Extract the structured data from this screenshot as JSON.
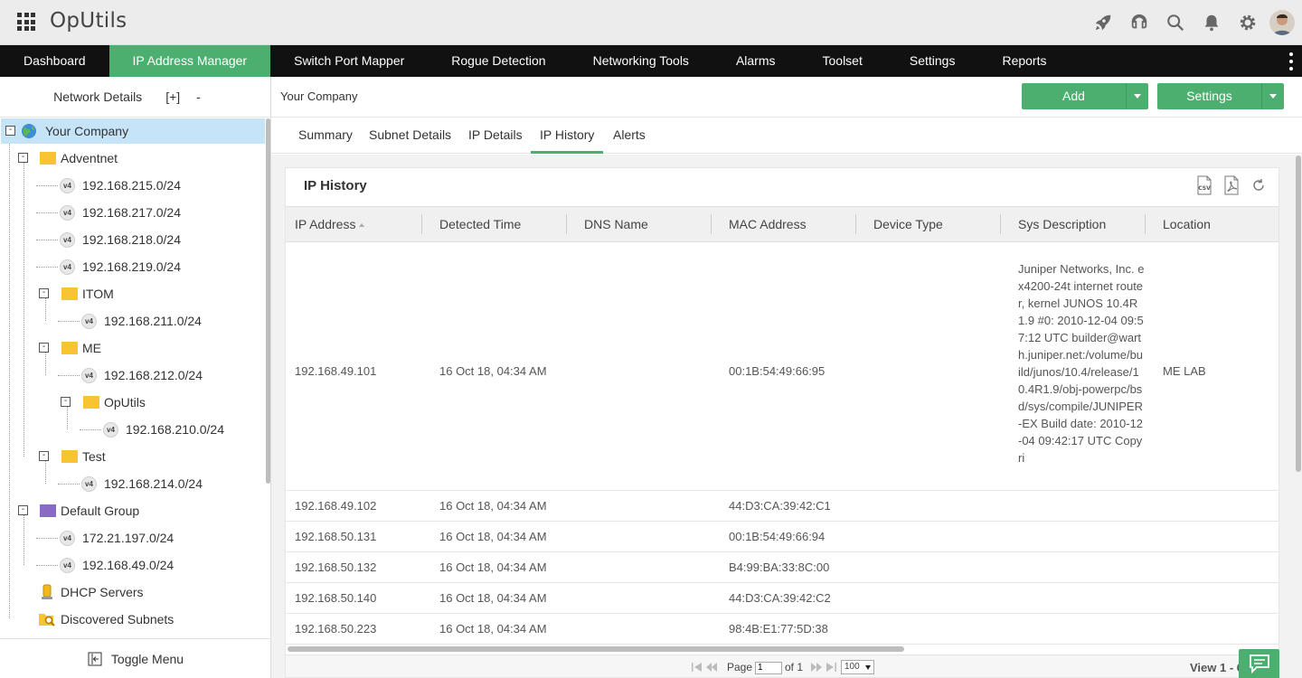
{
  "app": {
    "title": "OpUtils"
  },
  "nav": {
    "items": [
      {
        "label": "Dashboard"
      },
      {
        "label": "IP Address Manager"
      },
      {
        "label": "Switch Port Mapper"
      },
      {
        "label": "Rogue Detection"
      },
      {
        "label": "Networking Tools"
      },
      {
        "label": "Alarms"
      },
      {
        "label": "Toolset"
      },
      {
        "label": "Settings"
      },
      {
        "label": "Reports"
      }
    ],
    "active": "IP Address Manager"
  },
  "sidebar": {
    "title": "Network Details",
    "expand_label": "[+]",
    "collapse_label": "-",
    "tree": [
      {
        "label": "Your Company"
      },
      {
        "label": "Adventnet"
      },
      {
        "label": "192.168.215.0/24"
      },
      {
        "label": "192.168.217.0/24"
      },
      {
        "label": "192.168.218.0/24"
      },
      {
        "label": "192.168.219.0/24"
      },
      {
        "label": "ITOM"
      },
      {
        "label": "192.168.211.0/24"
      },
      {
        "label": "ME"
      },
      {
        "label": "192.168.212.0/24"
      },
      {
        "label": "OpUtils"
      },
      {
        "label": "192.168.210.0/24"
      },
      {
        "label": "Test"
      },
      {
        "label": "192.168.214.0/24"
      },
      {
        "label": "Default Group"
      },
      {
        "label": "172.21.197.0/24"
      },
      {
        "label": "192.168.49.0/24"
      },
      {
        "label": "DHCP Servers"
      },
      {
        "label": "Discovered Subnets"
      }
    ],
    "version_badge": "v4",
    "toggle_menu": "Toggle Menu"
  },
  "header": {
    "company": "Your Company",
    "add_button": "Add",
    "settings_button": "Settings"
  },
  "tabs": [
    {
      "label": "Summary"
    },
    {
      "label": "Subnet Details"
    },
    {
      "label": "IP Details"
    },
    {
      "label": "IP History"
    },
    {
      "label": "Alerts"
    }
  ],
  "active_tab": "IP History",
  "panel": {
    "title": "IP History",
    "columns": [
      "IP Address",
      "Detected Time",
      "DNS Name",
      "MAC Address",
      "Device Type",
      "Sys Description",
      "Location"
    ],
    "rows": [
      {
        "ip": "192.168.49.101",
        "time": "16 Oct 18, 04:34 AM",
        "dns": "",
        "mac": "00:1B:54:49:66:95",
        "device": "",
        "sysdesc": "Juniper Networks, Inc. ex4200-24t internet router, kernel JUNOS 10.4R1.9 #0: 2010-12-04 09:57:12 UTC builder@warth.juniper.net:/volume/build/junos/10.4/release/10.4R1.9/obj-powerpc/bsd/sys/compile/JUNIPER-EX Build date: 2010-12-04 09:42:17 UTC Copyri",
        "location": "ME LAB"
      },
      {
        "ip": "192.168.49.102",
        "time": "16 Oct 18, 04:34 AM",
        "dns": "",
        "mac": "44:D3:CA:39:42:C1",
        "device": "",
        "sysdesc": "",
        "location": ""
      },
      {
        "ip": "192.168.50.131",
        "time": "16 Oct 18, 04:34 AM",
        "dns": "",
        "mac": "00:1B:54:49:66:94",
        "device": "",
        "sysdesc": "",
        "location": ""
      },
      {
        "ip": "192.168.50.132",
        "time": "16 Oct 18, 04:34 AM",
        "dns": "",
        "mac": "B4:99:BA:33:8C:00",
        "device": "",
        "sysdesc": "",
        "location": ""
      },
      {
        "ip": "192.168.50.140",
        "time": "16 Oct 18, 04:34 AM",
        "dns": "",
        "mac": "44:D3:CA:39:42:C2",
        "device": "",
        "sysdesc": "",
        "location": ""
      },
      {
        "ip": "192.168.50.223",
        "time": "16 Oct 18, 04:34 AM",
        "dns": "",
        "mac": "98:4B:E1:77:5D:38",
        "device": "",
        "sysdesc": "",
        "location": ""
      }
    ],
    "export_csv": "CSV"
  },
  "pager": {
    "page_label": "Page",
    "page_value": "1",
    "of_label": "of 1",
    "page_size": "100",
    "view_text": "View 1 - 6"
  },
  "colors": {
    "accent": "#4caf6f",
    "nav_bg": "#111111",
    "selected": "#c6e4f7"
  }
}
